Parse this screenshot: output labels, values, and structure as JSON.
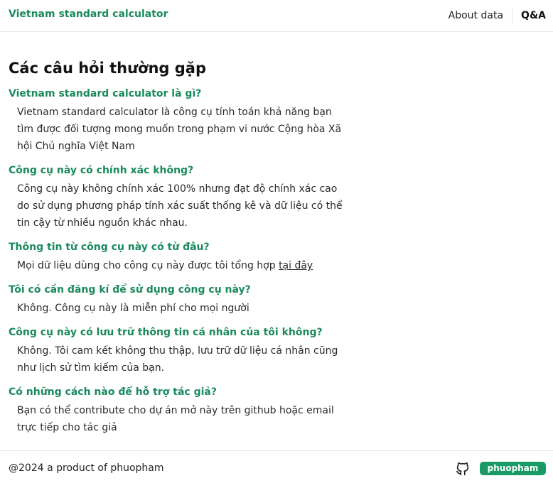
{
  "header": {
    "brand": "Vietnam standard calculator",
    "nav_about": "About data",
    "nav_qa": "Q&A"
  },
  "main": {
    "title": "Các câu hỏi thường gặp",
    "faqs": [
      {
        "q": "Vietnam standard calculator là gì?",
        "a": "Vietnam standard calculator là công cụ tính toán khả năng bạn tìm được đối tượng mong muốn trong phạm vi nước Cộng hòa Xã hội Chủ nghĩa Việt Nam"
      },
      {
        "q": "Công cụ này có chính xác không?",
        "a": "Công cụ này không chính xác 100% nhưng đạt độ chính xác cao do sử dụng phương pháp tính xác suất thống kê và dữ liệu có thể tin cậy từ nhiều nguồn khác nhau."
      },
      {
        "q": "Thông tin từ công cụ này có từ đâu?",
        "a": "Mọi dữ liệu dùng cho công cụ này được tôi tổng hợp",
        "link": "tại đây"
      },
      {
        "q": "Tôi có cần đăng kí để sử dụng công cụ này?",
        "a": "Không. Công cụ này là miễn phí cho mọi người"
      },
      {
        "q": "Công cụ này có lưu trữ thông tin cá nhân của tôi không?",
        "a": "Không. Tôi cam kết không thu thập, lưu trữ dữ liệu cá nhân cũng như lịch sử tìm kiếm của bạn."
      },
      {
        "q": "Có những cách nào để hỗ trợ tác giả?",
        "a": "Bạn có thể contribute cho dự án mở này trên github hoặc email trực tiếp cho tác giả"
      }
    ]
  },
  "footer": {
    "copyright": "@2024 a product of phuopham",
    "github_icon": "github-icon",
    "badge": "phuopham",
    "accent_color": "#1a9a66"
  }
}
